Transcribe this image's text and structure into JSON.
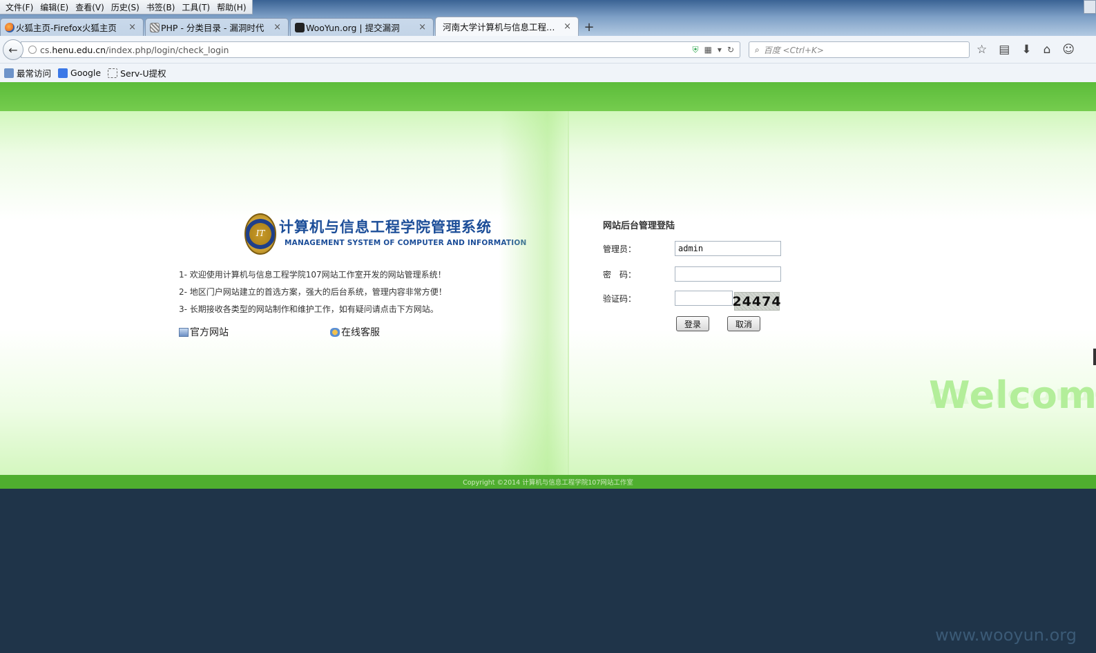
{
  "menu": [
    "文件(F)",
    "编辑(E)",
    "查看(V)",
    "历史(S)",
    "书签(B)",
    "工具(T)",
    "帮助(H)"
  ],
  "tabs": [
    {
      "label": "火狐主页-Firefox火狐主页",
      "icon": "firefox-icon",
      "color": "#e8742c"
    },
    {
      "label": "PHP - 分类目录 - 漏洞时代",
      "icon": "exploit-site-icon",
      "color": "#8a8a8a"
    },
    {
      "label": "WooYun.org | 提交漏洞",
      "icon": "wooyun-icon",
      "color": "#222222"
    },
    {
      "label": "河南大学计算机与信息工程学...",
      "icon": "page-icon",
      "color": "#ffffff"
    }
  ],
  "nav": {
    "url_prefix": "cs.",
    "url_domain": "henu.edu.cn",
    "url_path": "/index.php/login/check_login",
    "search_placeholder": "百度 <Ctrl+K>"
  },
  "bookmarks": [
    {
      "label": "最常访问",
      "icon": "most-visited-icon"
    },
    {
      "label": "Google",
      "icon": "google-icon"
    },
    {
      "label": "Serv-U提权",
      "icon": "page-icon"
    }
  ],
  "page": {
    "logo_seal_text": "IT",
    "logo_cn": "计算机与信息工程学院管理系统",
    "logo_en": "MANAGEMENT SYSTEM OF COMPUTER AND INFORMATION",
    "intro": [
      "1- 欢迎使用计算机与信息工程学院107网站工作室开发的网站管理系统！",
      "2- 地区门户网站建立的首选方案，强大的后台系统，管理内容非常方便！",
      "3- 长期接收各类型的网站制作和维护工作，如有疑问请点击下方网站。"
    ],
    "links": {
      "official": "官方网站",
      "service": "在线客服"
    },
    "login": {
      "title": "网站后台管理登陆",
      "admin_label": "管理员：",
      "admin_value": "admin",
      "password_label": "密　码：",
      "password_value": "",
      "captcha_label": "验证码：",
      "captcha_value": "",
      "captcha_image_text": "24474",
      "login_button": "登录",
      "cancel_button": "取消"
    },
    "welcome": "Welcome",
    "copyright": "Copyright ©2014 计算机与信息工程学院107网站工作室"
  },
  "watermark": "www.wooyun.org",
  "colors": {
    "green_band": "#5cbc3a",
    "footer": "#4fae2f",
    "background": "#1f3449",
    "logo_blue": "#1b4d98"
  }
}
